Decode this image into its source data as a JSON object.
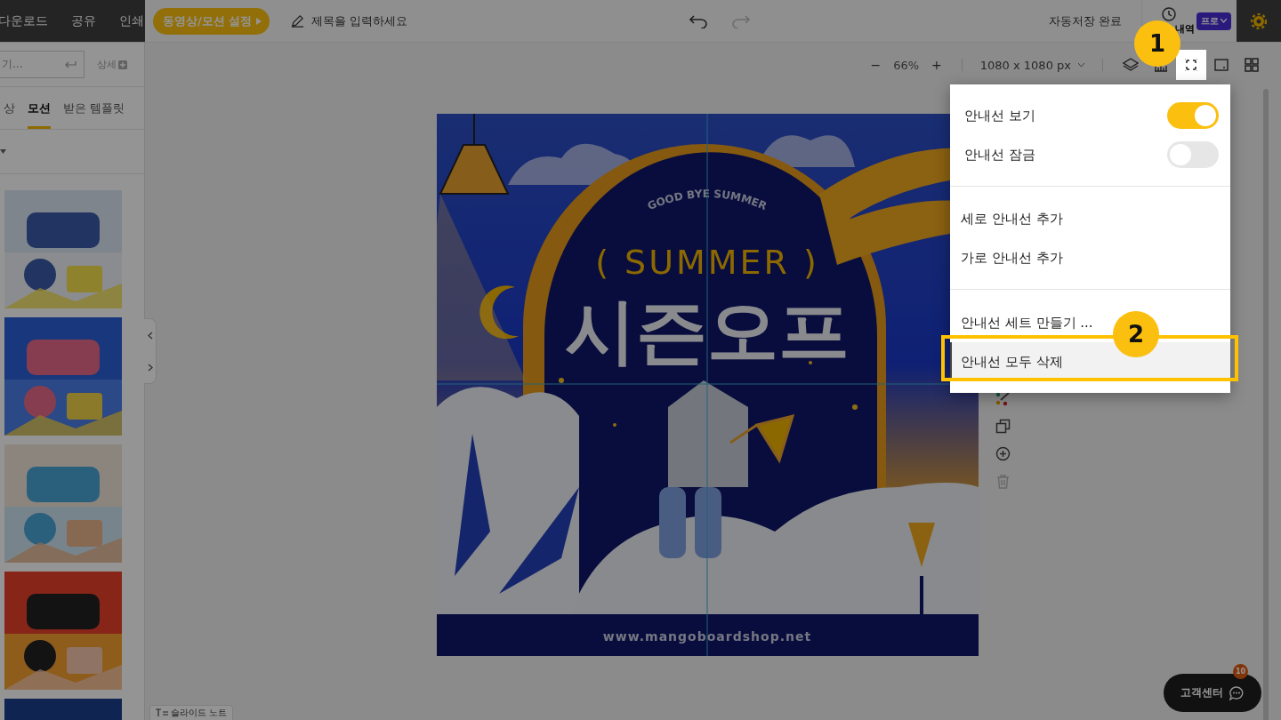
{
  "top_bar": {
    "menu": [
      {
        "label": "다운로드"
      },
      {
        "label": "공유"
      },
      {
        "label": "인쇄"
      }
    ],
    "video_button": "동영상/모션 설정",
    "title_placeholder": "제목을 입력하세요",
    "autosave": "자동저장 완료",
    "history_label": "내역",
    "plan_badge": "프로"
  },
  "sidebar": {
    "search": {
      "placeholder": "기..."
    },
    "detail": "상세",
    "tabs": [
      {
        "label": "상",
        "selected": false
      },
      {
        "label": "모션",
        "selected": true
      },
      {
        "label": "받은 템플릿",
        "selected": false
      }
    ]
  },
  "canvas_toolbar": {
    "zoom_out": "−",
    "zoom": "66%",
    "zoom_in": "+",
    "size": "1080 x 1080 px"
  },
  "design": {
    "arch_text": "GOOD BYE SUMMER",
    "headline": "( SUMMER )",
    "title": "시즌오프",
    "footer": "www.mangoboardshop.net"
  },
  "side_tools": [
    {
      "kind": "palette",
      "disabled": false
    },
    {
      "kind": "copy",
      "disabled": false
    },
    {
      "kind": "add",
      "disabled": false
    },
    {
      "kind": "delete",
      "disabled": true
    }
  ],
  "guide_menu": {
    "sections": [
      [
        {
          "kind": "toggle",
          "label": "안내선 보기",
          "on": true
        },
        {
          "kind": "toggle",
          "label": "안내선 잠금",
          "on": false
        }
      ],
      [
        {
          "kind": "action",
          "label": "세로 안내선 추가",
          "selected": false
        },
        {
          "kind": "action",
          "label": "가로 안내선 추가",
          "selected": false
        }
      ],
      [
        {
          "kind": "action",
          "label": "안내선 세트 만들기 ...",
          "selected": false
        },
        {
          "kind": "action",
          "label": "안내선 모두 삭제",
          "selected": true
        }
      ]
    ]
  },
  "callouts": [
    {
      "number": "1"
    },
    {
      "number": "2"
    }
  ],
  "slide_note": "슬라이드 노트",
  "support": {
    "label": "고객센터",
    "badge": "10"
  }
}
